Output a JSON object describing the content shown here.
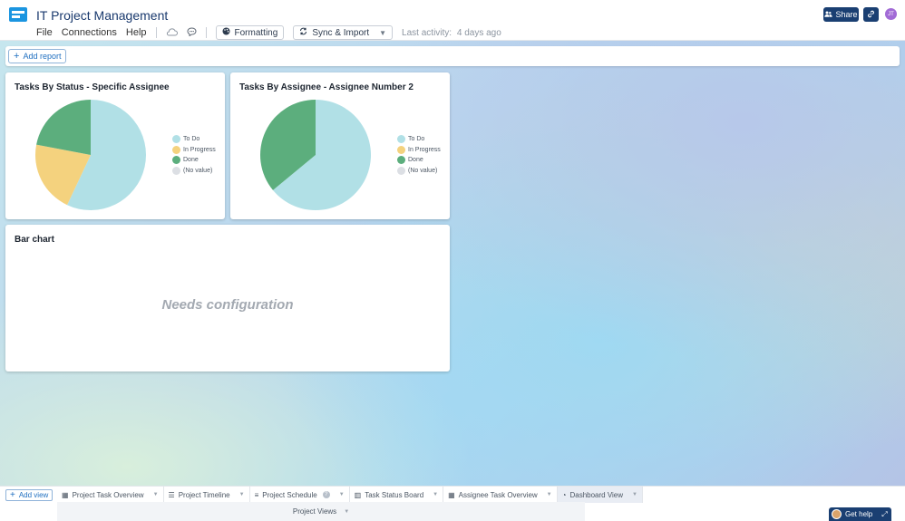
{
  "app": {
    "title": "IT Project Management",
    "menu": [
      "File",
      "Connections",
      "Help"
    ],
    "formatting_label": "Formatting",
    "sync_label": "Sync & Import",
    "activity_label": "Last activity:",
    "activity_value": "4 days ago",
    "share_label": "Share",
    "avatar_initials": "JT",
    "accent_color": "#1a3f72",
    "icons": [
      "cloud-icon",
      "comment-icon",
      "palette-icon",
      "sync-icon",
      "share-users-icon",
      "link-icon"
    ]
  },
  "dashboard": {
    "add_report_label": "Add report",
    "cards": [
      {
        "title": "Tasks By Status - Specific Assignee",
        "legend": [
          "To Do",
          "In Progress",
          "Done",
          "(No value)"
        ]
      },
      {
        "title": "Tasks By Assignee - Assignee Number 2",
        "legend": [
          "To Do",
          "In Progress",
          "Done",
          "(No value)"
        ]
      },
      {
        "title": "Bar chart",
        "placeholder": "Needs configuration"
      }
    ]
  },
  "chart_data": [
    {
      "type": "pie",
      "title": "Tasks By Status - Specific Assignee",
      "categories": [
        "To Do",
        "In Progress",
        "Done",
        "(No value)"
      ],
      "values": [
        57,
        21,
        22,
        0
      ],
      "colors": [
        "#b1e0e6",
        "#f4d27e",
        "#5cae7d",
        "#dcdfe4"
      ]
    },
    {
      "type": "pie",
      "title": "Tasks By Assignee - Assignee Number 2",
      "categories": [
        "To Do",
        "In Progress",
        "Done",
        "(No value)"
      ],
      "values": [
        64,
        0,
        36,
        0
      ],
      "colors": [
        "#b1e0e6",
        "#f4d27e",
        "#5cae7d",
        "#dcdfe4"
      ]
    }
  ],
  "views": {
    "add_view_label": "Add view",
    "tabs": [
      {
        "label": "Project Task Overview",
        "icon": "table-icon",
        "active": false
      },
      {
        "label": "Project Timeline",
        "icon": "timeline-icon",
        "active": false
      },
      {
        "label": "Project Schedule",
        "icon": "gantt-icon",
        "active": false
      },
      {
        "label": "Task Status Board",
        "icon": "board-icon",
        "active": false
      },
      {
        "label": "Assignee Task Overview",
        "icon": "table-icon",
        "active": false
      },
      {
        "label": "Dashboard View",
        "icon": "dashboard-icon",
        "active": true
      }
    ],
    "group_label": "Project Views",
    "get_help_label": "Get help"
  }
}
